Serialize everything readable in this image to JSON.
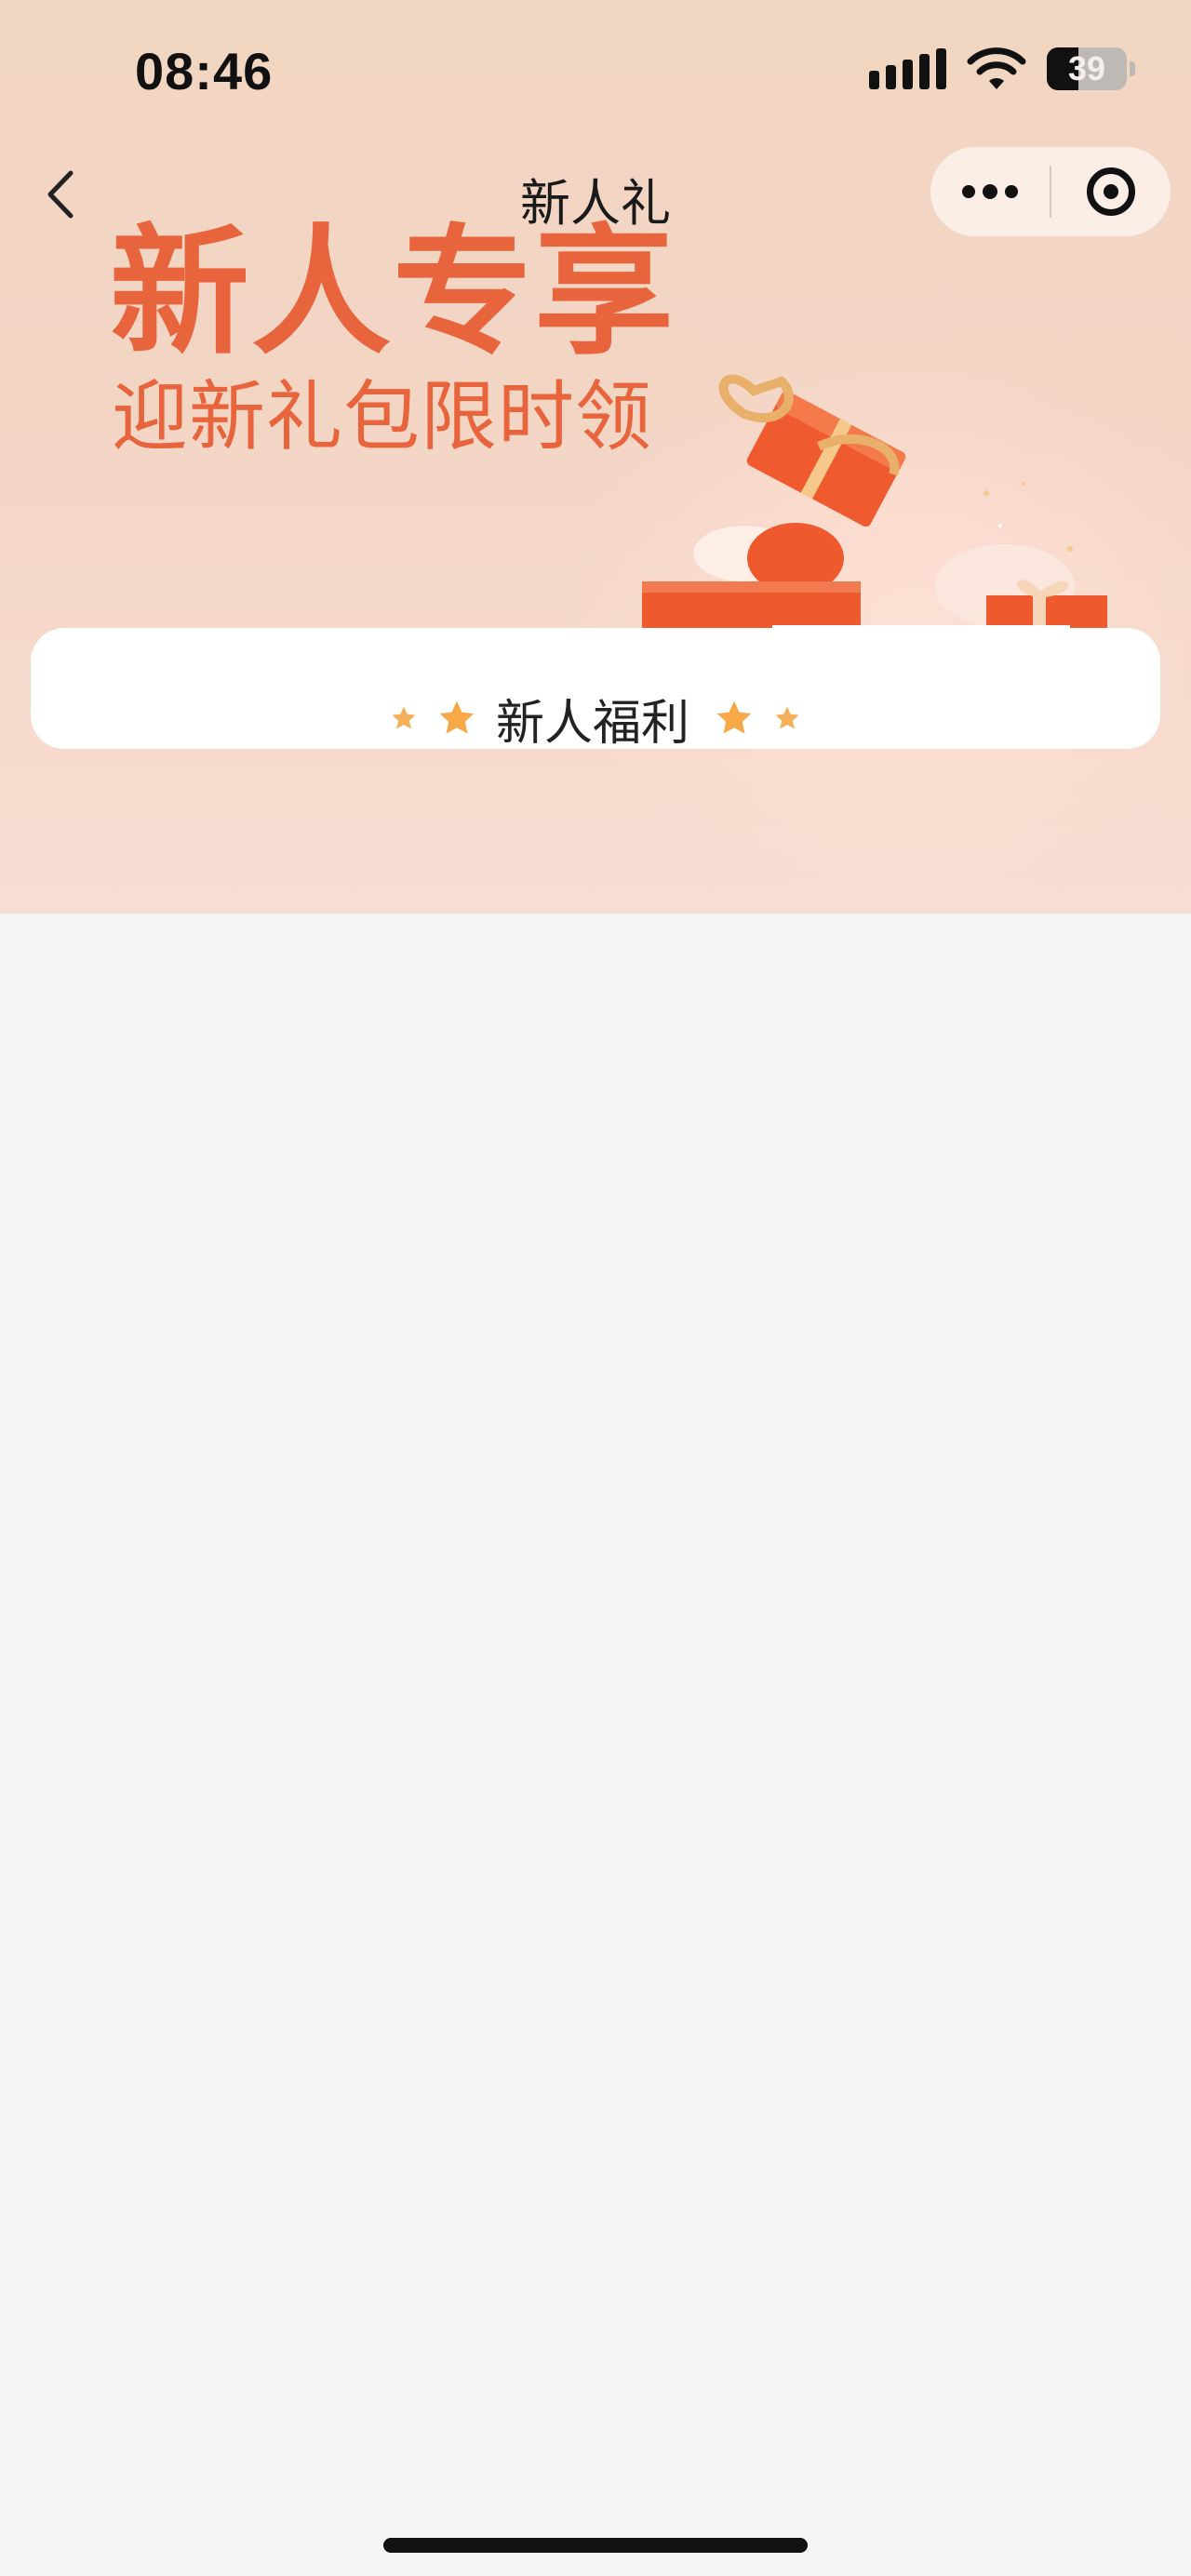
{
  "status_bar": {
    "time": "08:46",
    "battery_level": "39",
    "icons": [
      "signal-icon",
      "wifi-icon",
      "battery-icon"
    ]
  },
  "nav": {
    "back_icon": "chevron-left-icon",
    "title": "新人礼",
    "more_icon": "more-dots-icon",
    "close_icon": "close-target-icon"
  },
  "banner": {
    "headline": "新人专享",
    "subline": "迎新礼包限时领",
    "colors": {
      "accent": "#e8643c",
      "background": "#f2d6c4"
    }
  },
  "welfare_card": {
    "title": "新人福利",
    "decoration_icon": "star-icon"
  },
  "page": {
    "background": "#f5f5f5"
  }
}
